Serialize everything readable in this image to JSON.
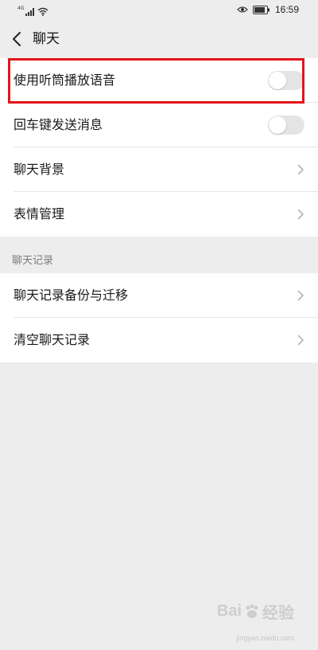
{
  "status_bar": {
    "network_label": "4G",
    "time": "16:59"
  },
  "header": {
    "title": "聊天"
  },
  "chat_settings": {
    "items": [
      {
        "label": "使用听筒播放语音",
        "control": "toggle",
        "enabled": false
      },
      {
        "label": "回车键发送消息",
        "control": "toggle",
        "enabled": false
      },
      {
        "label": "聊天背景",
        "control": "chevron"
      },
      {
        "label": "表情管理",
        "control": "chevron"
      }
    ]
  },
  "chat_history": {
    "section_title": "聊天记录",
    "items": [
      {
        "label": "聊天记录备份与迁移"
      },
      {
        "label": "清空聊天记录"
      }
    ]
  },
  "watermark": {
    "text": "Bai",
    "suffix": "经验",
    "sub": "jingyan.baidu.com"
  },
  "colors": {
    "page_bg": "#ededed",
    "row_bg": "#ffffff",
    "highlight": "#e4141b",
    "toggle_off": "#e4e4e4"
  }
}
